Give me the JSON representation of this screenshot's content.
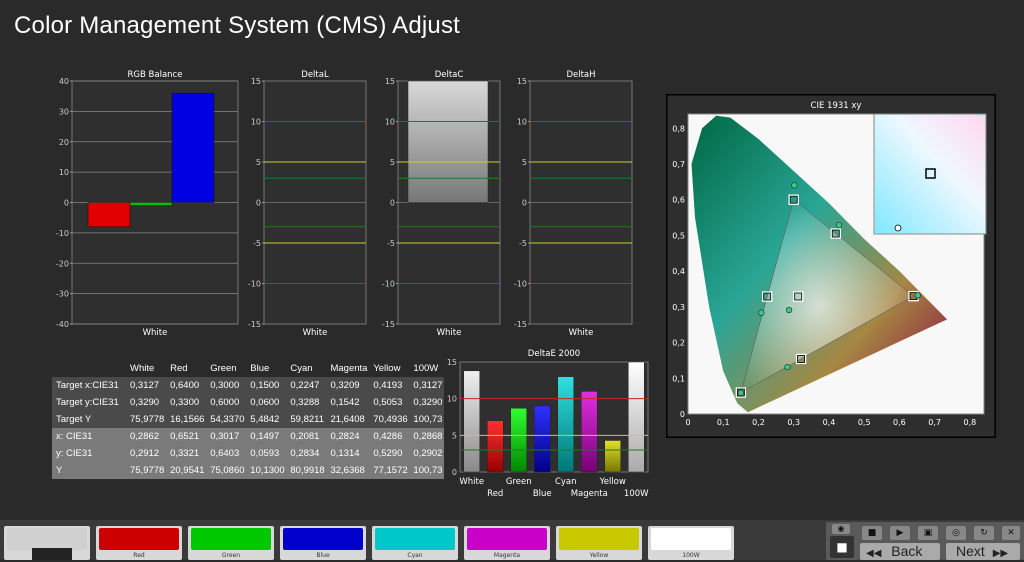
{
  "title": "Color Management System (CMS) Adjust",
  "colors": {
    "red": "#e00000",
    "green": "#00c000",
    "blue": "#0000e0",
    "cyan": "#00c8c8",
    "magenta": "#c800c8",
    "yellow": "#c8c800",
    "white": "#e8e8e8",
    "limit_red": "#cc2222",
    "limit_yellow": "#cccc33",
    "limit_green": "#227722"
  },
  "chart_data": [
    {
      "type": "bar",
      "title": "RGB Balance",
      "categories": [
        "White"
      ],
      "series": [
        {
          "name": "Red",
          "values": [
            -8
          ]
        },
        {
          "name": "Green",
          "values": [
            -1
          ]
        },
        {
          "name": "Blue",
          "values": [
            36
          ]
        }
      ],
      "ylim": [
        -40,
        40
      ],
      "ticks": [
        40,
        30,
        20,
        10,
        0,
        -10,
        -20,
        -30,
        -40
      ]
    },
    {
      "type": "bar",
      "title": "DeltaL",
      "categories": [
        "White"
      ],
      "values": [
        0
      ],
      "ylim": [
        -15,
        15
      ],
      "ticks": [
        15,
        10,
        5,
        0,
        -5,
        -10,
        -15
      ]
    },
    {
      "type": "bar",
      "title": "DeltaC",
      "categories": [
        "White"
      ],
      "values": [
        15
      ],
      "ylim": [
        -15,
        15
      ],
      "ticks": [
        15,
        10,
        5,
        0,
        -5,
        -10,
        -15
      ]
    },
    {
      "type": "bar",
      "title": "DeltaH",
      "categories": [
        "White"
      ],
      "values": [
        0
      ],
      "ylim": [
        -15,
        15
      ],
      "ticks": [
        15,
        10,
        5,
        0,
        -5,
        -10,
        -15
      ]
    },
    {
      "type": "bar",
      "title": "DeltaE 2000",
      "categories": [
        "White",
        "Red",
        "Green",
        "Blue",
        "Cyan",
        "Magenta",
        "Yellow",
        "100W"
      ],
      "values": [
        13.8,
        7,
        8.7,
        9,
        13,
        11,
        4.3,
        15
      ],
      "ylim": [
        0,
        15
      ],
      "ticks": [
        15,
        10,
        5,
        0
      ]
    },
    {
      "type": "scatter",
      "title": "CIE 1931 xy",
      "xticks": [
        "0",
        "0,1",
        "0,2",
        "0,3",
        "0,4",
        "0,5",
        "0,6",
        "0,7",
        "0,8"
      ],
      "yticks": [
        "0,8",
        "0,7",
        "0,6",
        "0,5",
        "0,4",
        "0,3",
        "0,2",
        "0,1",
        "0"
      ],
      "targets": [
        [
          0.64,
          0.33
        ],
        [
          0.3,
          0.6
        ],
        [
          0.15,
          0.06
        ],
        [
          0.2247,
          0.3288
        ],
        [
          0.3209,
          0.1542
        ],
        [
          0.4193,
          0.5053
        ],
        [
          0.3127,
          0.329
        ]
      ],
      "measured": [
        [
          0.6521,
          0.3321
        ],
        [
          0.3017,
          0.6403
        ],
        [
          0.1497,
          0.0593
        ],
        [
          0.2081,
          0.2834
        ],
        [
          0.2824,
          0.1314
        ],
        [
          0.4286,
          0.529
        ],
        [
          0.2868,
          0.2912
        ]
      ]
    }
  ],
  "table": {
    "headers": [
      "",
      "White",
      "Red",
      "Green",
      "Blue",
      "Cyan",
      "Magenta",
      "Yellow",
      "100W"
    ],
    "rows": [
      [
        "Target x:CIE31",
        "0,3127",
        "0,6400",
        "0,3000",
        "0,1500",
        "0,2247",
        "0,3209",
        "0,4193",
        "0,3127"
      ],
      [
        "Target y:CIE31",
        "0,3290",
        "0,3300",
        "0,6000",
        "0,0600",
        "0,3288",
        "0,1542",
        "0,5053",
        "0,3290"
      ],
      [
        "Target Y",
        "75,9778",
        "16,1566",
        "54,3370",
        "5,4842",
        "59,8211",
        "21,6408",
        "70,4936",
        "100,73"
      ],
      [
        "x: CIE31",
        "0,2862",
        "0,6521",
        "0,3017",
        "0,1497",
        "0,2081",
        "0,2824",
        "0,4286",
        "0,2868"
      ],
      [
        "y: CIE31",
        "0,2912",
        "0,3321",
        "0,6403",
        "0,0593",
        "0,2834",
        "0,1314",
        "0,5290",
        "0,2902"
      ],
      [
        "Y",
        "75,9778",
        "20,9541",
        "75,0860",
        "10,1300",
        "80,9918",
        "32,6368",
        "77,1572",
        "100,73"
      ]
    ]
  },
  "swatches": [
    {
      "label": "",
      "color": "#d0d0d0"
    },
    {
      "label": "Red",
      "color": "#cc0000"
    },
    {
      "label": "Green",
      "color": "#00c800"
    },
    {
      "label": "Blue",
      "color": "#0000cc"
    },
    {
      "label": "Cyan",
      "color": "#00c8c8"
    },
    {
      "label": "Magenta",
      "color": "#c800c8"
    },
    {
      "label": "Yellow",
      "color": "#c8c800"
    },
    {
      "label": "100W",
      "color": "#ffffff"
    }
  ],
  "nav": {
    "back": "Back",
    "next": "Next"
  }
}
